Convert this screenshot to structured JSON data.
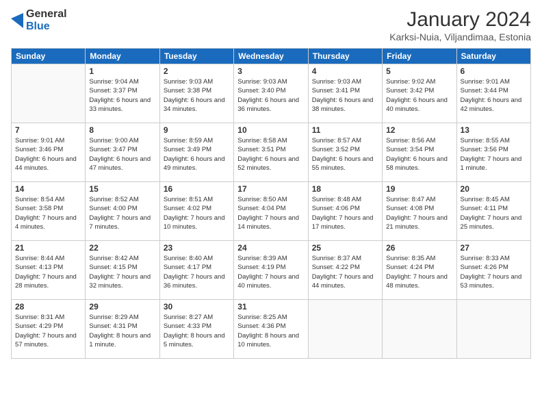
{
  "header": {
    "logo_general": "General",
    "logo_blue": "Blue",
    "month_year": "January 2024",
    "location": "Karksi-Nuia, Viljandimaa, Estonia"
  },
  "weekdays": [
    "Sunday",
    "Monday",
    "Tuesday",
    "Wednesday",
    "Thursday",
    "Friday",
    "Saturday"
  ],
  "weeks": [
    [
      {
        "day": "",
        "sunrise": "",
        "sunset": "",
        "daylight": ""
      },
      {
        "day": "1",
        "sunrise": "Sunrise: 9:04 AM",
        "sunset": "Sunset: 3:37 PM",
        "daylight": "Daylight: 6 hours and 33 minutes."
      },
      {
        "day": "2",
        "sunrise": "Sunrise: 9:03 AM",
        "sunset": "Sunset: 3:38 PM",
        "daylight": "Daylight: 6 hours and 34 minutes."
      },
      {
        "day": "3",
        "sunrise": "Sunrise: 9:03 AM",
        "sunset": "Sunset: 3:40 PM",
        "daylight": "Daylight: 6 hours and 36 minutes."
      },
      {
        "day": "4",
        "sunrise": "Sunrise: 9:03 AM",
        "sunset": "Sunset: 3:41 PM",
        "daylight": "Daylight: 6 hours and 38 minutes."
      },
      {
        "day": "5",
        "sunrise": "Sunrise: 9:02 AM",
        "sunset": "Sunset: 3:42 PM",
        "daylight": "Daylight: 6 hours and 40 minutes."
      },
      {
        "day": "6",
        "sunrise": "Sunrise: 9:01 AM",
        "sunset": "Sunset: 3:44 PM",
        "daylight": "Daylight: 6 hours and 42 minutes."
      }
    ],
    [
      {
        "day": "7",
        "sunrise": "Sunrise: 9:01 AM",
        "sunset": "Sunset: 3:46 PM",
        "daylight": "Daylight: 6 hours and 44 minutes."
      },
      {
        "day": "8",
        "sunrise": "Sunrise: 9:00 AM",
        "sunset": "Sunset: 3:47 PM",
        "daylight": "Daylight: 6 hours and 47 minutes."
      },
      {
        "day": "9",
        "sunrise": "Sunrise: 8:59 AM",
        "sunset": "Sunset: 3:49 PM",
        "daylight": "Daylight: 6 hours and 49 minutes."
      },
      {
        "day": "10",
        "sunrise": "Sunrise: 8:58 AM",
        "sunset": "Sunset: 3:51 PM",
        "daylight": "Daylight: 6 hours and 52 minutes."
      },
      {
        "day": "11",
        "sunrise": "Sunrise: 8:57 AM",
        "sunset": "Sunset: 3:52 PM",
        "daylight": "Daylight: 6 hours and 55 minutes."
      },
      {
        "day": "12",
        "sunrise": "Sunrise: 8:56 AM",
        "sunset": "Sunset: 3:54 PM",
        "daylight": "Daylight: 6 hours and 58 minutes."
      },
      {
        "day": "13",
        "sunrise": "Sunrise: 8:55 AM",
        "sunset": "Sunset: 3:56 PM",
        "daylight": "Daylight: 7 hours and 1 minute."
      }
    ],
    [
      {
        "day": "14",
        "sunrise": "Sunrise: 8:54 AM",
        "sunset": "Sunset: 3:58 PM",
        "daylight": "Daylight: 7 hours and 4 minutes."
      },
      {
        "day": "15",
        "sunrise": "Sunrise: 8:52 AM",
        "sunset": "Sunset: 4:00 PM",
        "daylight": "Daylight: 7 hours and 7 minutes."
      },
      {
        "day": "16",
        "sunrise": "Sunrise: 8:51 AM",
        "sunset": "Sunset: 4:02 PM",
        "daylight": "Daylight: 7 hours and 10 minutes."
      },
      {
        "day": "17",
        "sunrise": "Sunrise: 8:50 AM",
        "sunset": "Sunset: 4:04 PM",
        "daylight": "Daylight: 7 hours and 14 minutes."
      },
      {
        "day": "18",
        "sunrise": "Sunrise: 8:48 AM",
        "sunset": "Sunset: 4:06 PM",
        "daylight": "Daylight: 7 hours and 17 minutes."
      },
      {
        "day": "19",
        "sunrise": "Sunrise: 8:47 AM",
        "sunset": "Sunset: 4:08 PM",
        "daylight": "Daylight: 7 hours and 21 minutes."
      },
      {
        "day": "20",
        "sunrise": "Sunrise: 8:45 AM",
        "sunset": "Sunset: 4:11 PM",
        "daylight": "Daylight: 7 hours and 25 minutes."
      }
    ],
    [
      {
        "day": "21",
        "sunrise": "Sunrise: 8:44 AM",
        "sunset": "Sunset: 4:13 PM",
        "daylight": "Daylight: 7 hours and 28 minutes."
      },
      {
        "day": "22",
        "sunrise": "Sunrise: 8:42 AM",
        "sunset": "Sunset: 4:15 PM",
        "daylight": "Daylight: 7 hours and 32 minutes."
      },
      {
        "day": "23",
        "sunrise": "Sunrise: 8:40 AM",
        "sunset": "Sunset: 4:17 PM",
        "daylight": "Daylight: 7 hours and 36 minutes."
      },
      {
        "day": "24",
        "sunrise": "Sunrise: 8:39 AM",
        "sunset": "Sunset: 4:19 PM",
        "daylight": "Daylight: 7 hours and 40 minutes."
      },
      {
        "day": "25",
        "sunrise": "Sunrise: 8:37 AM",
        "sunset": "Sunset: 4:22 PM",
        "daylight": "Daylight: 7 hours and 44 minutes."
      },
      {
        "day": "26",
        "sunrise": "Sunrise: 8:35 AM",
        "sunset": "Sunset: 4:24 PM",
        "daylight": "Daylight: 7 hours and 48 minutes."
      },
      {
        "day": "27",
        "sunrise": "Sunrise: 8:33 AM",
        "sunset": "Sunset: 4:26 PM",
        "daylight": "Daylight: 7 hours and 53 minutes."
      }
    ],
    [
      {
        "day": "28",
        "sunrise": "Sunrise: 8:31 AM",
        "sunset": "Sunset: 4:29 PM",
        "daylight": "Daylight: 7 hours and 57 minutes."
      },
      {
        "day": "29",
        "sunrise": "Sunrise: 8:29 AM",
        "sunset": "Sunset: 4:31 PM",
        "daylight": "Daylight: 8 hours and 1 minute."
      },
      {
        "day": "30",
        "sunrise": "Sunrise: 8:27 AM",
        "sunset": "Sunset: 4:33 PM",
        "daylight": "Daylight: 8 hours and 5 minutes."
      },
      {
        "day": "31",
        "sunrise": "Sunrise: 8:25 AM",
        "sunset": "Sunset: 4:36 PM",
        "daylight": "Daylight: 8 hours and 10 minutes."
      },
      {
        "day": "",
        "sunrise": "",
        "sunset": "",
        "daylight": ""
      },
      {
        "day": "",
        "sunrise": "",
        "sunset": "",
        "daylight": ""
      },
      {
        "day": "",
        "sunrise": "",
        "sunset": "",
        "daylight": ""
      }
    ]
  ]
}
